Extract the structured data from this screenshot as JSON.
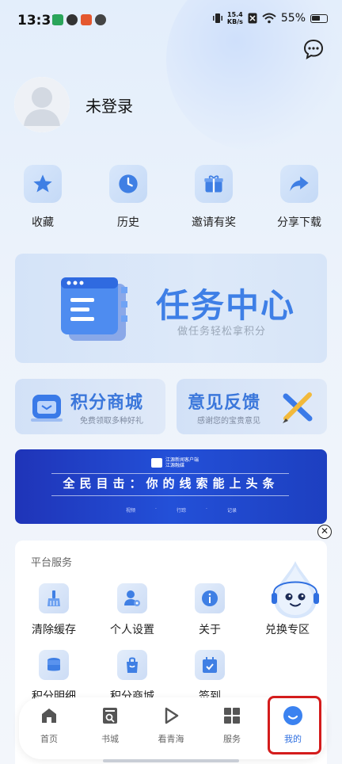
{
  "status_bar": {
    "time": "13:31",
    "net_speed_value": "15.4",
    "net_speed_unit": "KB/s",
    "battery": "55%"
  },
  "user": {
    "login_status": "未登录"
  },
  "quick_actions": [
    {
      "label": "收藏",
      "icon": "star-icon"
    },
    {
      "label": "历史",
      "icon": "clock-icon"
    },
    {
      "label": "邀请有奖",
      "icon": "gift-icon"
    },
    {
      "label": "分享下载",
      "icon": "share-icon"
    }
  ],
  "task_banner": {
    "title": "任务中心",
    "subtitle": "做任务轻松拿积分"
  },
  "points_mall_card": {
    "title": "积分商城",
    "subtitle": "免费领取多种好礼"
  },
  "feedback_card": {
    "title": "意见反馈",
    "subtitle": "感谢您的宝贵意见"
  },
  "promo_banner": {
    "logo_text": "江源新闻客户端",
    "logo_sub": "江源融媒",
    "title": "全民目击：你的线索能上头条",
    "tags": [
      "视频",
      "·",
      "行踪",
      "·",
      "记录"
    ]
  },
  "platform_services": {
    "title": "平台服务",
    "items": [
      {
        "label": "清除缓存",
        "icon": "broom-icon"
      },
      {
        "label": "个人设置",
        "icon": "user-settings-icon"
      },
      {
        "label": "关于",
        "icon": "info-icon"
      },
      {
        "label": "兑换专区",
        "icon": "mascot-icon"
      },
      {
        "label": "积分明细",
        "icon": "coins-icon"
      },
      {
        "label": "积分商城",
        "icon": "shopping-bag-icon"
      },
      {
        "label": "签到",
        "icon": "checkin-icon"
      }
    ]
  },
  "tab_bar": [
    {
      "label": "首页",
      "icon": "home-icon"
    },
    {
      "label": "书城",
      "icon": "book-search-icon"
    },
    {
      "label": "看青海",
      "icon": "play-icon"
    },
    {
      "label": "服务",
      "icon": "grid-icon"
    },
    {
      "label": "我的",
      "icon": "smile-icon",
      "active": true
    }
  ],
  "colors": {
    "accent": "#3e7fe6",
    "highlight_box": "#d41c1c",
    "promo_bg": "#2350d8"
  }
}
